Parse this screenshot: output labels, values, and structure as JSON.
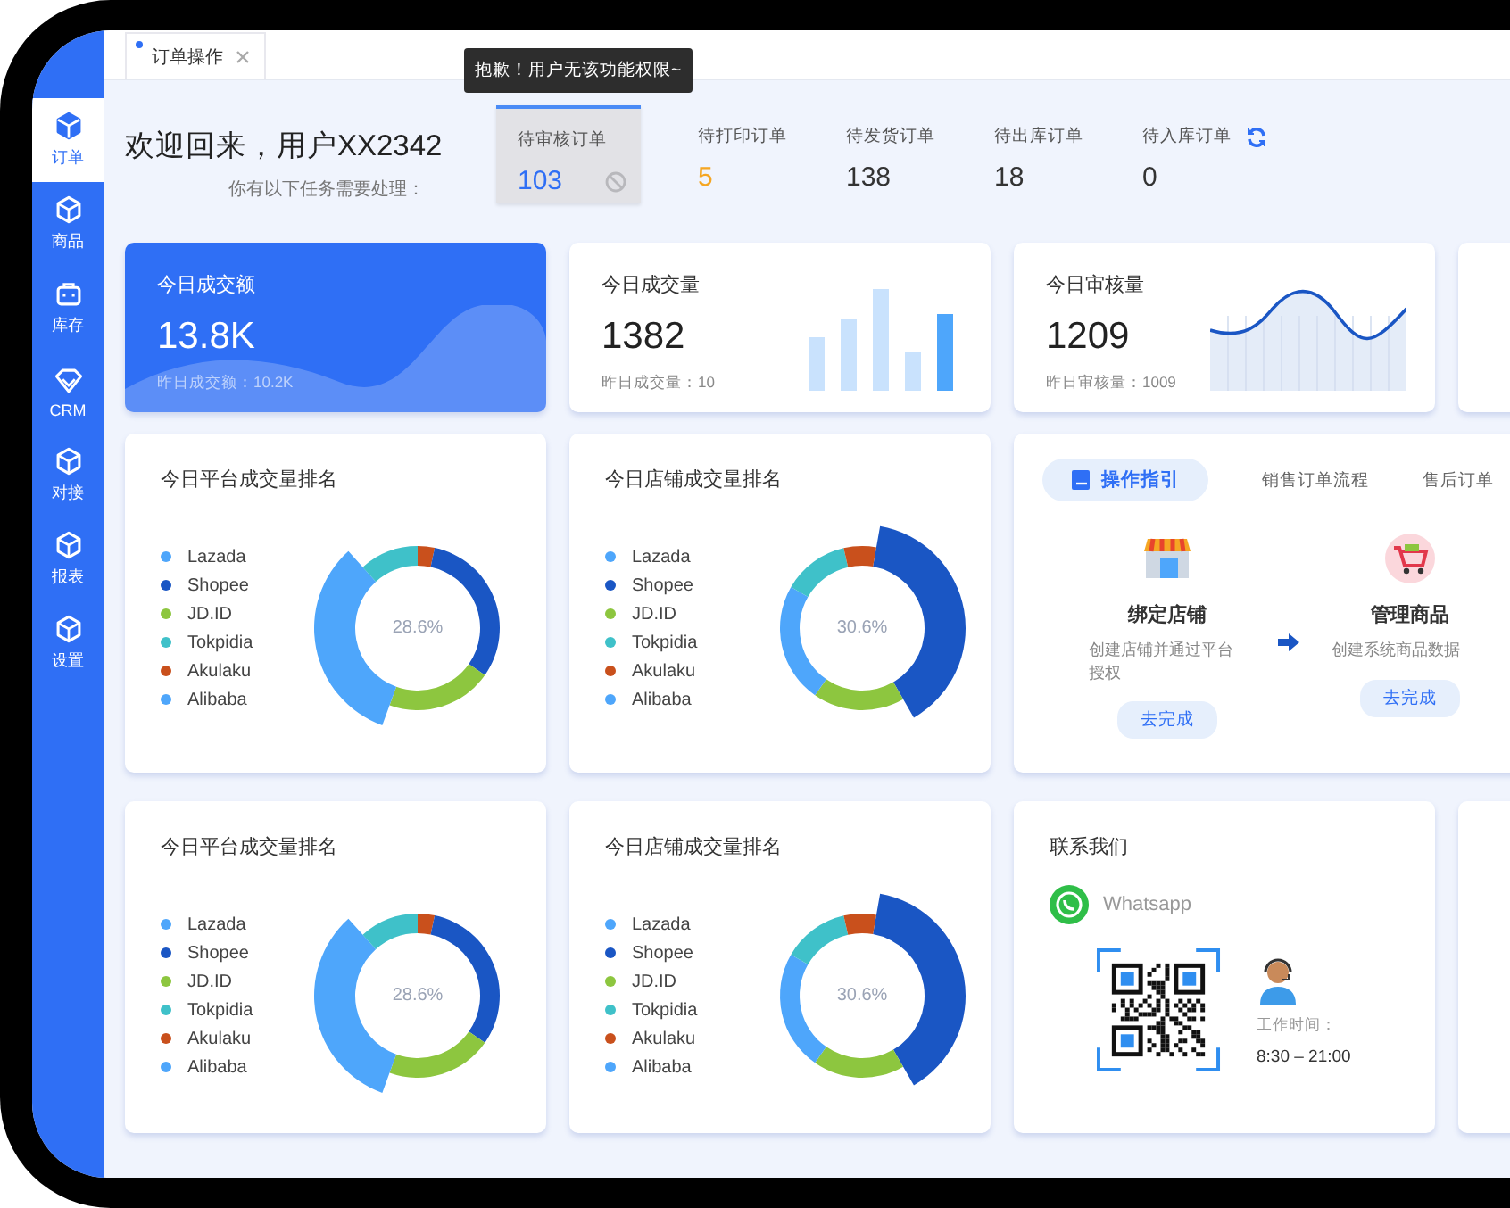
{
  "sidebar": {
    "items": [
      {
        "label": "订单",
        "selected": true
      },
      {
        "label": "商品",
        "selected": false
      },
      {
        "label": "库存",
        "selected": false
      },
      {
        "label": "CRM",
        "selected": false
      },
      {
        "label": "对接",
        "selected": false
      },
      {
        "label": "报表",
        "selected": false
      },
      {
        "label": "设置",
        "selected": false
      }
    ]
  },
  "tabs": [
    {
      "label": "订单操作",
      "selected": true
    }
  ],
  "tooltip": "抱歉！用户无该功能权限~",
  "welcome": {
    "title": "欢迎回来，用户XX2342",
    "subtitle": "你有以下任务需要处理："
  },
  "tasks": [
    {
      "label": "待审核订单",
      "value": "103",
      "color": "#2f6ff5",
      "disabled": true
    },
    {
      "label": "待打印订单",
      "value": "5",
      "color": "#f5a623",
      "disabled": false
    },
    {
      "label": "待发货订单",
      "value": "138",
      "color": "#333333",
      "disabled": false
    },
    {
      "label": "待出库订单",
      "value": "18",
      "color": "#333333",
      "disabled": false
    },
    {
      "label": "待入库订单",
      "value": "0",
      "color": "#333333",
      "disabled": false
    }
  ],
  "kpis": [
    {
      "kind": "area",
      "highlighted": true,
      "title": "今日成交额",
      "value": "13.8K",
      "compare": "昨日成交额：10.2K"
    },
    {
      "kind": "bars",
      "highlighted": false,
      "title": "今日成交量",
      "value": "1382",
      "compare": "昨日成交量：10"
    },
    {
      "kind": "line",
      "highlighted": false,
      "title": "今日审核量",
      "value": "1209",
      "compare": "昨日审核量：1009"
    }
  ],
  "rankings_top": [
    {
      "title": "今日平台成交量排名",
      "center": "28.6%",
      "legend": [
        {
          "label": "Lazada",
          "color": "#4ea6fb"
        },
        {
          "label": "Shopee",
          "color": "#1a56c4"
        },
        {
          "label": "JD.ID",
          "color": "#8dc63f"
        },
        {
          "label": "Tokpidia",
          "color": "#3fc1c9"
        },
        {
          "label": "Akulaku",
          "color": "#c9501c"
        },
        {
          "label": "Alibaba",
          "color": "#4ea6fb"
        }
      ]
    },
    {
      "title": "今日店铺成交量排名",
      "center": "30.6%",
      "legend": [
        {
          "label": "Lazada",
          "color": "#4ea6fb"
        },
        {
          "label": "Shopee",
          "color": "#1a56c4"
        },
        {
          "label": "JD.ID",
          "color": "#8dc63f"
        },
        {
          "label": "Tokpidia",
          "color": "#3fc1c9"
        },
        {
          "label": "Akulaku",
          "color": "#c9501c"
        },
        {
          "label": "Alibaba",
          "color": "#4ea6fb"
        }
      ]
    }
  ],
  "guide": {
    "tabs": [
      {
        "label": "操作指引",
        "selected": true
      },
      {
        "label": "销售订单流程",
        "selected": false
      },
      {
        "label": "售后订单",
        "selected": false
      }
    ],
    "steps": [
      {
        "title": "绑定店铺",
        "description": "创建店铺并通过平台授权",
        "button": "去完成"
      },
      {
        "title": "管理商品",
        "description": "创建系统商品数据",
        "button": "去完成"
      }
    ]
  },
  "rankings_bottom": [
    {
      "title": "今日平台成交量排名",
      "center": "28.6%",
      "legend": [
        {
          "label": "Lazada",
          "color": "#4ea6fb"
        },
        {
          "label": "Shopee",
          "color": "#1a56c4"
        },
        {
          "label": "JD.ID",
          "color": "#8dc63f"
        },
        {
          "label": "Tokpidia",
          "color": "#3fc1c9"
        },
        {
          "label": "Akulaku",
          "color": "#c9501c"
        },
        {
          "label": "Alibaba",
          "color": "#4ea6fb"
        }
      ]
    },
    {
      "title": "今日店铺成交量排名",
      "center": "30.6%",
      "legend": [
        {
          "label": "Lazada",
          "color": "#4ea6fb"
        },
        {
          "label": "Shopee",
          "color": "#1a56c4"
        },
        {
          "label": "JD.ID",
          "color": "#8dc63f"
        },
        {
          "label": "Tokpidia",
          "color": "#3fc1c9"
        },
        {
          "label": "Akulaku",
          "color": "#c9501c"
        },
        {
          "label": "Alibaba",
          "color": "#4ea6fb"
        }
      ]
    }
  ],
  "contact": {
    "title": "联系我们",
    "channel": "Whatsapp",
    "hours_label": "工作时间：",
    "hours": "8:30 – 21:00"
  }
}
